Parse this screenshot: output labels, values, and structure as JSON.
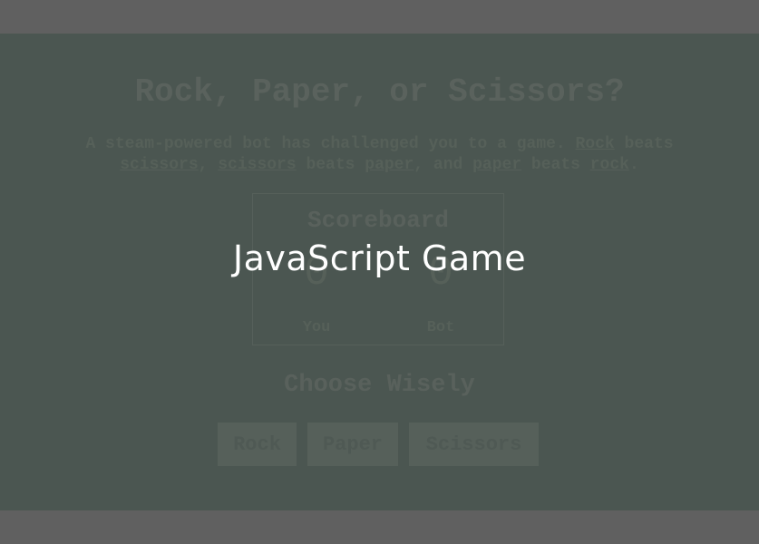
{
  "overlay": {
    "title": "JavaScript Game"
  },
  "game": {
    "title": "Rock, Paper, or Scissors?",
    "intro": {
      "t1": "A steam-powered bot has challenged you to a game. ",
      "w_rock": "Rock",
      "t2": " beats ",
      "w_scissors1": "scissors",
      "t3": ", ",
      "w_scissors2": "scissors",
      "t4": " beats ",
      "w_paper1": "paper",
      "t5": ", and ",
      "w_paper2": "paper",
      "t6": " beats ",
      "w_rock2": "rock",
      "t7": "."
    },
    "scoreboard": {
      "title": "Scoreboard",
      "you_score": "0",
      "you_label": "You",
      "bot_score": "0",
      "bot_label": "Bot"
    },
    "choose_label": "Choose Wisely",
    "buttons": {
      "rock": "Rock",
      "paper": "Paper",
      "scissors": "Scissors"
    }
  },
  "colors": {
    "panel": "#4b5651",
    "frame": "#606060",
    "overlay_text": "#ffffff"
  }
}
